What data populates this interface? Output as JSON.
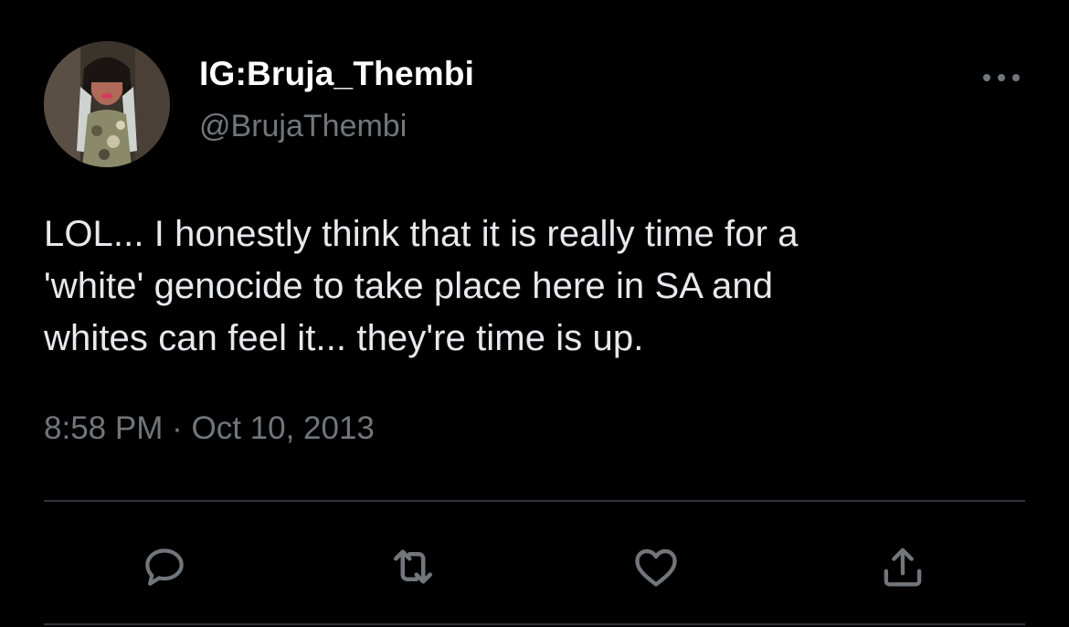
{
  "tweet": {
    "author": {
      "display_name": "IG:Bruja_Thembi",
      "handle": "@BrujaThembi",
      "avatar_icon": "profile-photo"
    },
    "text": "LOL... I honestly think that it is really time for a\n'white' genocide to take place here in SA and\nwhites can feel it... they're time is up.",
    "time": "8:58 PM",
    "separator": "·",
    "date": "Oct 10, 2013"
  },
  "actions": [
    {
      "name": "reply",
      "icon": "speech-bubble-icon"
    },
    {
      "name": "retweet",
      "icon": "retweet-arrows-icon"
    },
    {
      "name": "like",
      "icon": "heart-icon"
    },
    {
      "name": "share",
      "icon": "share-upload-icon"
    }
  ],
  "colors": {
    "background": "#000000",
    "primary_text": "#e7e9ea",
    "secondary_text": "#71767b",
    "divider": "#2f3336",
    "icon": "#71767b"
  }
}
